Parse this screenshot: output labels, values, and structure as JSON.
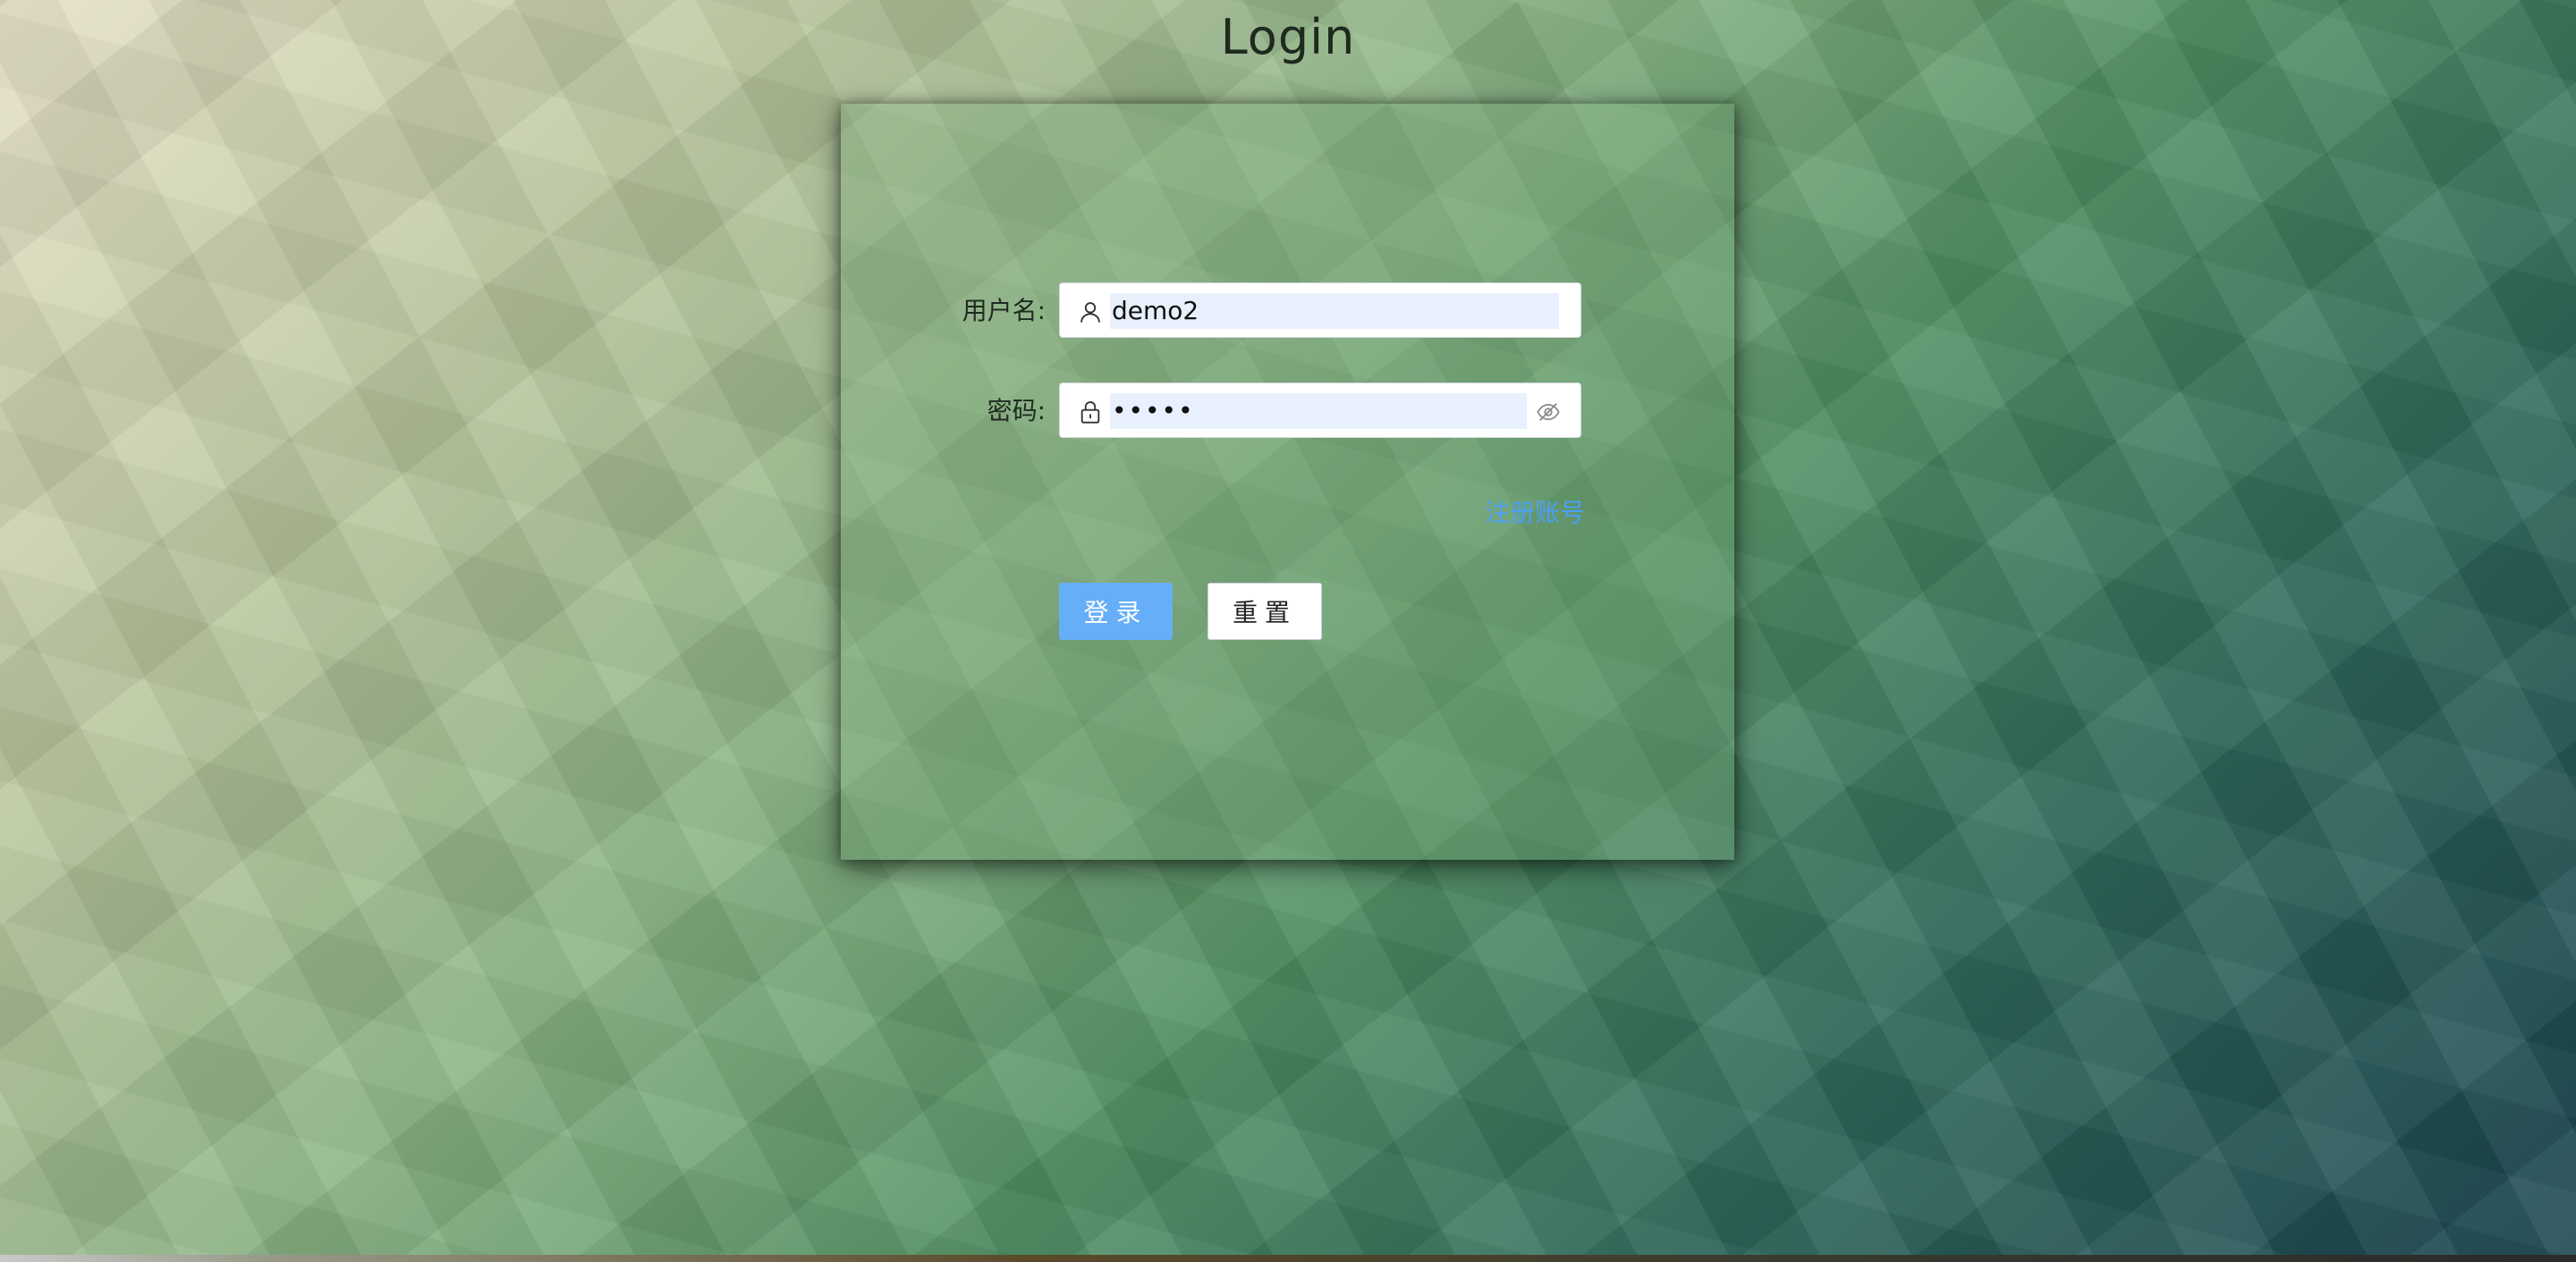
{
  "page": {
    "title": "Login"
  },
  "form": {
    "username": {
      "label": "用户名:",
      "value": "demo2",
      "icon": "user-icon"
    },
    "password": {
      "label": "密码:",
      "value": "•••••",
      "icon": "lock-icon",
      "toggle_icon": "eye-off-icon"
    },
    "register_link": "注册账号",
    "login_button": "登录",
    "reset_button": "重置"
  },
  "colors": {
    "primary_button": "#66aef8",
    "link": "#4aa0f4",
    "autofill_bg": "#e8f0fe"
  }
}
